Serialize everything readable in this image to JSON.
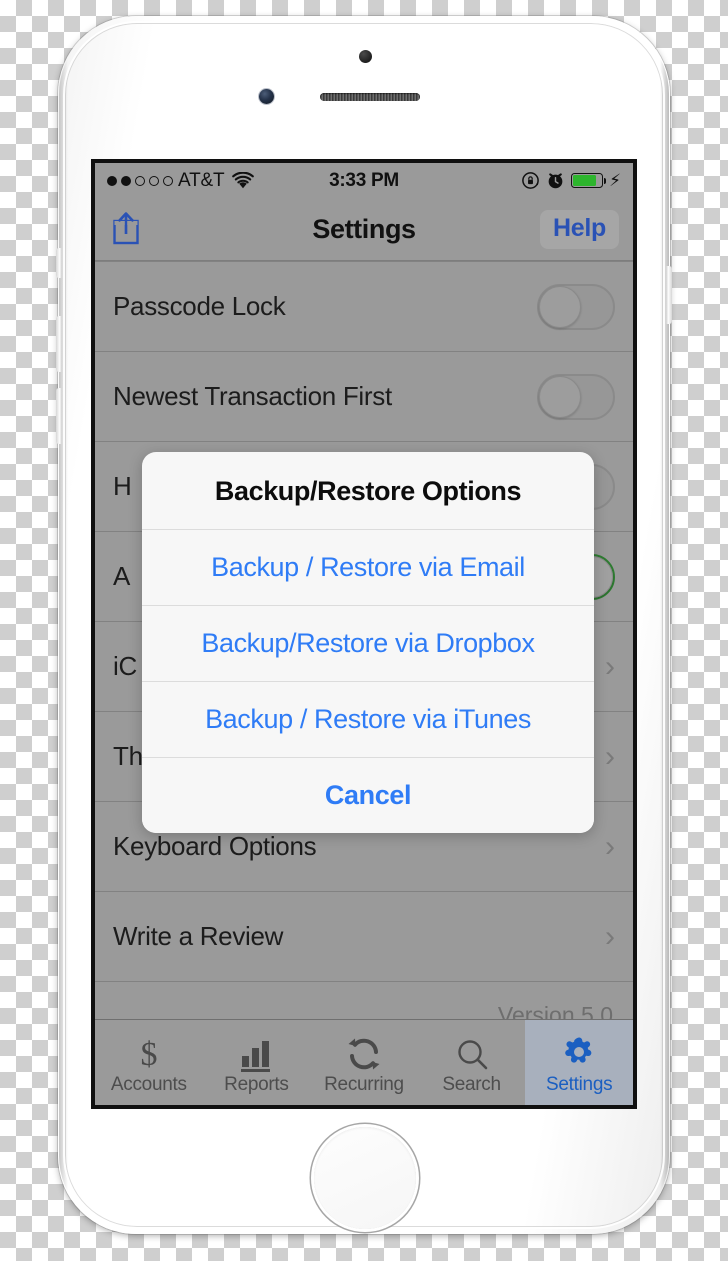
{
  "status_bar": {
    "signal_dots_filled": 2,
    "signal_dots_total": 5,
    "carrier": "AT&T",
    "time": "3:33 PM",
    "wifi_icon": "wifi-icon",
    "rotation_lock_icon": "rotation-lock-icon",
    "alarm_icon": "alarm-clock-icon",
    "battery_icon": "battery-icon",
    "charging_icon": "lightning-bolt-icon"
  },
  "nav_bar": {
    "share_icon": "share-icon",
    "title": "Settings",
    "help_label": "Help"
  },
  "settings_rows": [
    {
      "label": "Passcode Lock",
      "accessory": "toggle",
      "toggle_on": false
    },
    {
      "label": "Newest Transaction First",
      "accessory": "toggle",
      "toggle_on": false
    },
    {
      "label": "H",
      "accessory": "toggle",
      "toggle_on": false
    },
    {
      "label": "A",
      "accessory": "toggle",
      "toggle_on": true
    },
    {
      "label": "iC",
      "accessory": "chevron",
      "toggle_on": false
    },
    {
      "label": "Th",
      "accessory": "chevron",
      "toggle_on": false
    },
    {
      "label": "Keyboard Options",
      "accessory": "chevron",
      "toggle_on": false
    },
    {
      "label": "Write a Review",
      "accessory": "chevron",
      "toggle_on": false
    }
  ],
  "version_label": "Version 5.0",
  "alert": {
    "title": "Backup/Restore Options",
    "buttons": [
      "Backup / Restore via Email",
      "Backup/Restore via Dropbox",
      "Backup / Restore via iTunes"
    ],
    "cancel_label": "Cancel"
  },
  "tab_bar": {
    "tabs": [
      {
        "label": "Accounts",
        "icon": "dollar-icon",
        "active": false
      },
      {
        "label": "Reports",
        "icon": "bar-chart-icon",
        "active": false
      },
      {
        "label": "Recurring",
        "icon": "refresh-icon",
        "active": false
      },
      {
        "label": "Search",
        "icon": "search-icon",
        "active": false
      },
      {
        "label": "Settings",
        "icon": "gear-icon",
        "active": true
      }
    ]
  },
  "colors": {
    "accent_blue": "#2f7cf6",
    "nav_blue": "#2a52b5",
    "toggle_on_green": "#2f7d32",
    "battery_green": "#2db52d",
    "screen_gray": "#9a9a9a"
  }
}
